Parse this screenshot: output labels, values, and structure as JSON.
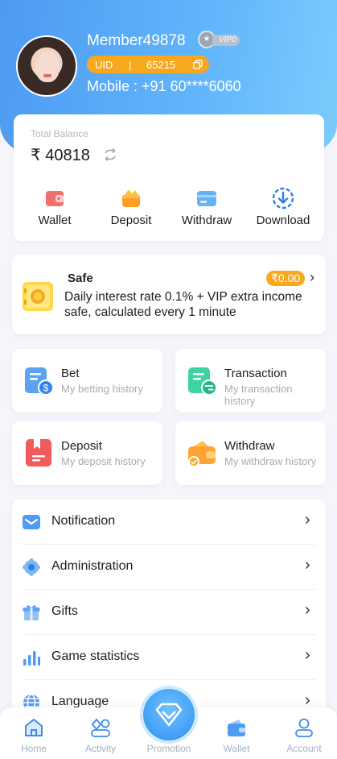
{
  "header": {
    "username": "Member49878",
    "vip_tag": "VIP0",
    "uid_label": "UID",
    "uid_separator": "|",
    "uid_value": "65215",
    "mobile": "Mobile : +91 60****6060"
  },
  "balance": {
    "label": "Total Balance",
    "amount": "₹ 40818",
    "actions": [
      {
        "label": "Wallet",
        "icon": "wallet-icon"
      },
      {
        "label": "Deposit",
        "icon": "deposit-icon"
      },
      {
        "label": "Withdraw",
        "icon": "withdraw-icon"
      },
      {
        "label": "Download",
        "icon": "download-icon"
      }
    ]
  },
  "safe": {
    "title": "Safe",
    "amount": "₹0.00",
    "description": "Daily interest rate 0.1% + VIP extra income safe, calculated every 1 minute"
  },
  "history": [
    {
      "title": "Bet",
      "subtitle": "My betting history"
    },
    {
      "title": "Transaction",
      "subtitle": "My transaction history"
    },
    {
      "title": "Deposit",
      "subtitle": "My deposit history"
    },
    {
      "title": "Withdraw",
      "subtitle": "My withdraw history"
    }
  ],
  "menu": [
    {
      "label": "Notification",
      "icon": "notification-icon"
    },
    {
      "label": "Administration",
      "icon": "administration-icon"
    },
    {
      "label": "Gifts",
      "icon": "gift-icon"
    },
    {
      "label": "Game statistics",
      "icon": "statistics-icon"
    },
    {
      "label": "Language",
      "icon": "language-icon"
    }
  ],
  "tabbar": {
    "home": "Home",
    "activity": "Activity",
    "promotion": "Promotion",
    "wallet": "Wallet",
    "account": "Account"
  },
  "colors": {
    "header_gradient_start": "#4d9af2",
    "header_gradient_end": "#7ccdfc",
    "accent_orange": "#f7a91e",
    "primary_blue": "#2e8ff0"
  }
}
